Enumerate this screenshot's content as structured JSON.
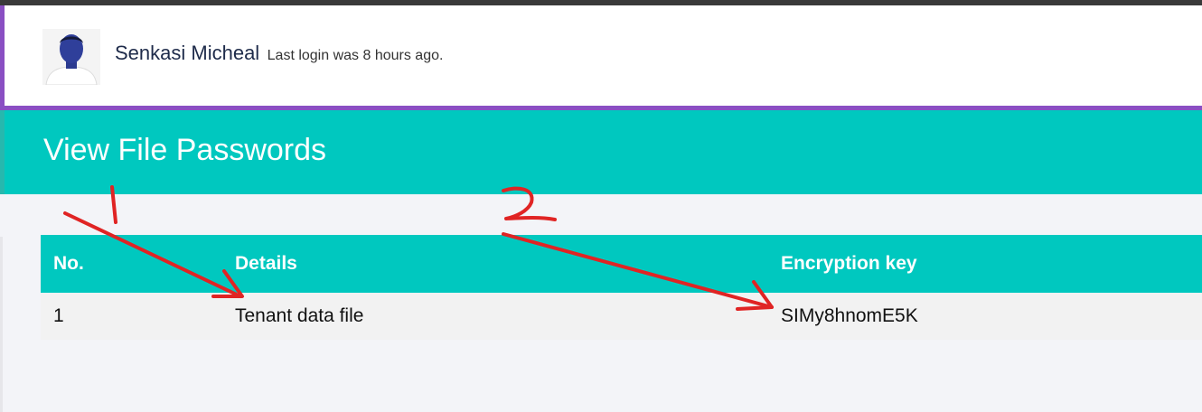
{
  "user": {
    "name": "Senkasi Micheal",
    "last_login": "Last login was 8 hours ago."
  },
  "page": {
    "title": "View File Passwords"
  },
  "table": {
    "headers": [
      "No.",
      "Details",
      "Encryption key"
    ],
    "rows": [
      [
        "1",
        "Tenant data file",
        "SIMy8hnomE5K"
      ]
    ]
  },
  "annotations": {
    "marker_1": "1",
    "marker_2": "2",
    "color": "#e02424"
  },
  "colors": {
    "accent_teal": "#00c8bf",
    "accent_purple": "#8a4fc3"
  }
}
